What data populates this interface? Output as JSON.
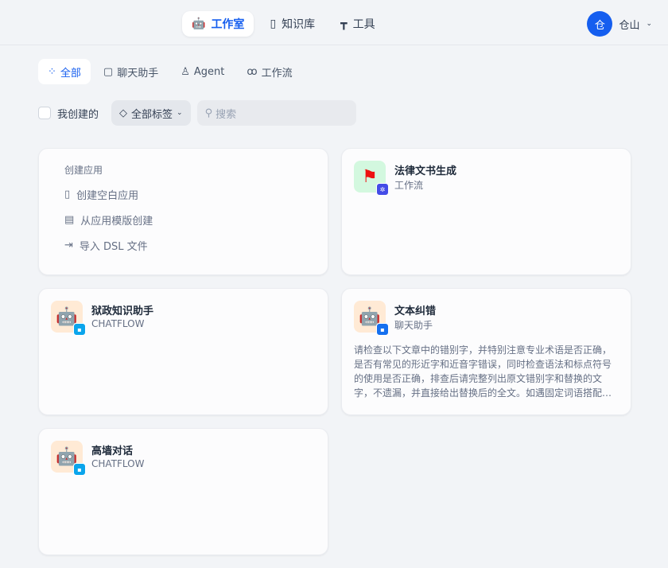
{
  "header": {
    "nav": [
      {
        "label": "工作室"
      },
      {
        "label": "知识库"
      },
      {
        "label": "工具"
      }
    ],
    "user": {
      "avatar": "仓",
      "name": "仓山"
    }
  },
  "tabs": [
    {
      "label": "全部"
    },
    {
      "label": "聊天助手"
    },
    {
      "label": "Agent"
    },
    {
      "label": "工作流"
    }
  ],
  "filters": {
    "mine": "我创建的",
    "tags": "全部标签",
    "search_placeholder": "搜索"
  },
  "create": {
    "title": "创建应用",
    "items": [
      {
        "label": "创建空白应用"
      },
      {
        "label": "从应用模版创建"
      },
      {
        "label": "导入 DSL 文件"
      }
    ]
  },
  "apps": [
    {
      "name": "法律文书生成",
      "type": "工作流",
      "desc": ""
    },
    {
      "name": "狱政知识助手",
      "type": "CHATFLOW",
      "desc": ""
    },
    {
      "name": "文本纠错",
      "type": "聊天助手",
      "desc": "请检查以下文章中的错别字，并特别注意专业术语是否正确，是否有常见的形近字和近音字错误，同时检查语法和标点符号的使用是否正确，排查后请完整列出原文错别字和替换的文字，不遗漏，并直接给出替换后的全文。如遇固定词语搭配问题，请一并指出。"
    },
    {
      "name": "高墙对话",
      "type": "CHATFLOW",
      "desc": ""
    }
  ],
  "colors": {
    "accent": "#155eef"
  }
}
